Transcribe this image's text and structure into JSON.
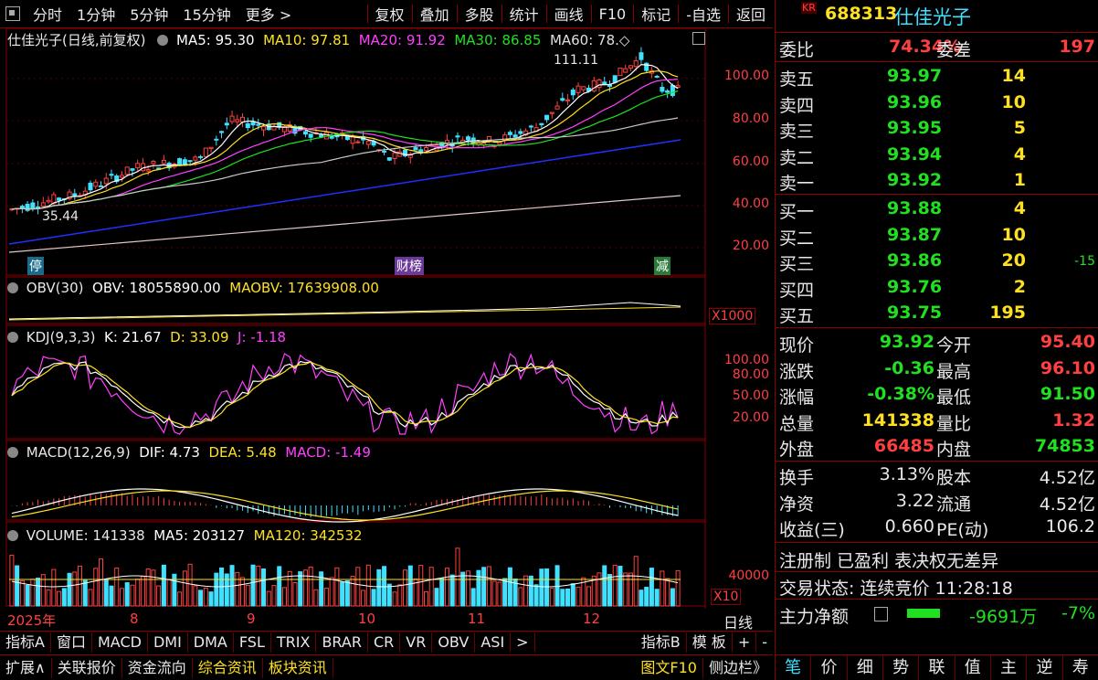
{
  "toolbar": {
    "items": [
      "分时",
      "1分钟",
      "5分钟",
      "15分钟",
      "更多 >"
    ],
    "items2": [
      "复权",
      "叠加",
      "多股",
      "统计",
      "画线",
      "F10",
      "标记",
      "-自选",
      "返回"
    ]
  },
  "chart": {
    "title": "仕佳光子(日线,前复权)",
    "ma": [
      {
        "label": "MA5: 95.30",
        "color": "#ffffff"
      },
      {
        "label": "MA10: 97.81",
        "color": "#ffe020"
      },
      {
        "label": "MA20: 91.92",
        "color": "#ff40ff"
      },
      {
        "label": "MA30: 86.85",
        "color": "#20e020"
      },
      {
        "label": "MA60: 78.◇",
        "color": "#e0e0e0"
      }
    ],
    "high_label": "111.11",
    "low_label": "35.44",
    "y_labels": [
      "100.00",
      "80.00",
      "60.00",
      "40.00",
      "20.00"
    ],
    "markers": [
      "停",
      "财榜",
      "减"
    ],
    "obv": {
      "name": "OBV(30)",
      "obv": "OBV: 18055890.00",
      "maobv": "MAOBV: 17639908.00",
      "unit": "X1000"
    },
    "kdj": {
      "name": "KDJ(9,3,3)",
      "k": "K: 21.67",
      "d": "D: 33.09",
      "j": "J: -1.18",
      "y_labels": [
        "100.00",
        "80.00",
        "50.00",
        "20.00"
      ]
    },
    "macd": {
      "name": "MACD(12,26,9)",
      "dif": "DIF: 4.73",
      "dea": "DEA: 5.48",
      "macd": "MACD: -1.49"
    },
    "volume": {
      "name": "VOLUME: 141338",
      "ma5": "MA5: 203127",
      "ma120": "MA120: 342532",
      "y_label": "40000",
      "unit": "X10"
    },
    "x_labels": [
      "2025年",
      "8",
      "9",
      "10",
      "11",
      "12"
    ],
    "period": "日线"
  },
  "tabs1": [
    "指标A",
    "窗口",
    "MACD",
    "DMI",
    "DMA",
    "FSL",
    "TRIX",
    "BRAR",
    "CR",
    "VR",
    "OBV",
    "ASI",
    ">"
  ],
  "tabs1_right": [
    "指标B",
    "模 板",
    "+",
    "-"
  ],
  "tabs2": [
    "扩展∧",
    "关联报价",
    "资金流向",
    "综合资讯",
    "板块资讯"
  ],
  "tabs2_right": [
    "图文F10",
    "侧边栏》"
  ],
  "right": {
    "code": "688313",
    "name": "仕佳光子",
    "badge": "KR",
    "wb": {
      "label": "委比",
      "value": "74.34%",
      "label2": "委差",
      "value2": "197"
    },
    "sell": [
      {
        "label": "卖五",
        "price": "93.97",
        "vol": "14"
      },
      {
        "label": "卖四",
        "price": "93.96",
        "vol": "10"
      },
      {
        "label": "卖三",
        "price": "93.95",
        "vol": "5"
      },
      {
        "label": "卖二",
        "price": "93.94",
        "vol": "4"
      },
      {
        "label": "卖一",
        "price": "93.92",
        "vol": "1"
      }
    ],
    "buy": [
      {
        "label": "买一",
        "price": "93.88",
        "vol": "4",
        "chg": ""
      },
      {
        "label": "买二",
        "price": "93.87",
        "vol": "10",
        "chg": ""
      },
      {
        "label": "买三",
        "price": "93.86",
        "vol": "20",
        "chg": "-15"
      },
      {
        "label": "买四",
        "price": "93.76",
        "vol": "2",
        "chg": ""
      },
      {
        "label": "买五",
        "price": "93.75",
        "vol": "195",
        "chg": ""
      }
    ],
    "stats": [
      {
        "l1": "现价",
        "v1": "93.92",
        "c1": "#20e020",
        "l2": "今开",
        "v2": "95.40",
        "c2": "#ff4040"
      },
      {
        "l1": "涨跌",
        "v1": "-0.36",
        "c1": "#20e020",
        "l2": "最高",
        "v2": "96.10",
        "c2": "#ff4040"
      },
      {
        "l1": "涨幅",
        "v1": "-0.38%",
        "c1": "#20e020",
        "l2": "最低",
        "v2": "91.50",
        "c2": "#20e020"
      },
      {
        "l1": "总量",
        "v1": "141338",
        "c1": "#ffe020",
        "l2": "量比",
        "v2": "1.32",
        "c2": "#ff4040"
      },
      {
        "l1": "外盘",
        "v1": "66485",
        "c1": "#ff4040",
        "l2": "内盘",
        "v2": "74853",
        "c2": "#20e020"
      }
    ],
    "stats2": [
      {
        "l1": "换手",
        "v1": "3.13%",
        "l2": "股本",
        "v2": "4.52亿"
      },
      {
        "l1": "净资",
        "v1": "3.22",
        "l2": "流通",
        "v2": "4.52亿"
      },
      {
        "l1": "收益(三)",
        "v1": "0.660",
        "l2": "PE(动)",
        "v2": "106.2"
      }
    ],
    "tags": "注册制 已盈利 表决权无差异",
    "trade_status": "交易状态: 连续竞价 11:28:18",
    "mainflow": {
      "label": "主力净额",
      "value": "-9691万",
      "pct": "-7%"
    },
    "bottom_tabs": [
      "笔",
      "价",
      "细",
      "势",
      "联",
      "值",
      "主",
      "逆",
      "寿"
    ]
  }
}
